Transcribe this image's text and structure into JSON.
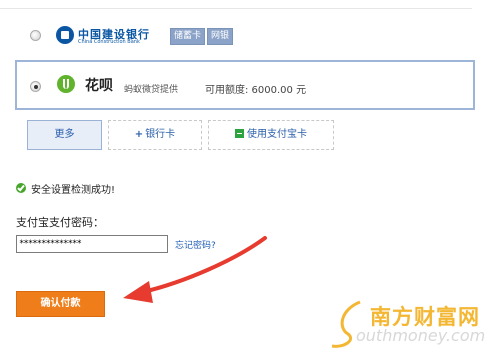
{
  "bank_option": {
    "logo_text_cn": "中国建设银行",
    "logo_text_en": "China Construction Bank",
    "tags": [
      "储蓄卡",
      "网银"
    ]
  },
  "huabei_option": {
    "name": "花呗",
    "provider": "蚂蚁微贷提供",
    "credit_text": "可用额度: 6000.00 元"
  },
  "options": {
    "more_label": "更多",
    "add_bank_label": "银行卡",
    "use_alipay_card_label": "使用支付宝卡"
  },
  "security": {
    "message": "安全设置检测成功!"
  },
  "password": {
    "label": "支付宝支付密码：",
    "masked_value": "**************",
    "forgot_link": "忘记密码?"
  },
  "confirm_button": "确认付款",
  "watermark": {
    "text_cn": "南方财富网",
    "text_en": "outhmoney.com"
  },
  "colors": {
    "confirm_bg": "#ef7d1a",
    "arrow": "#e63b2e",
    "link": "#1f5fb5",
    "selected_border": "#9db6d7"
  }
}
